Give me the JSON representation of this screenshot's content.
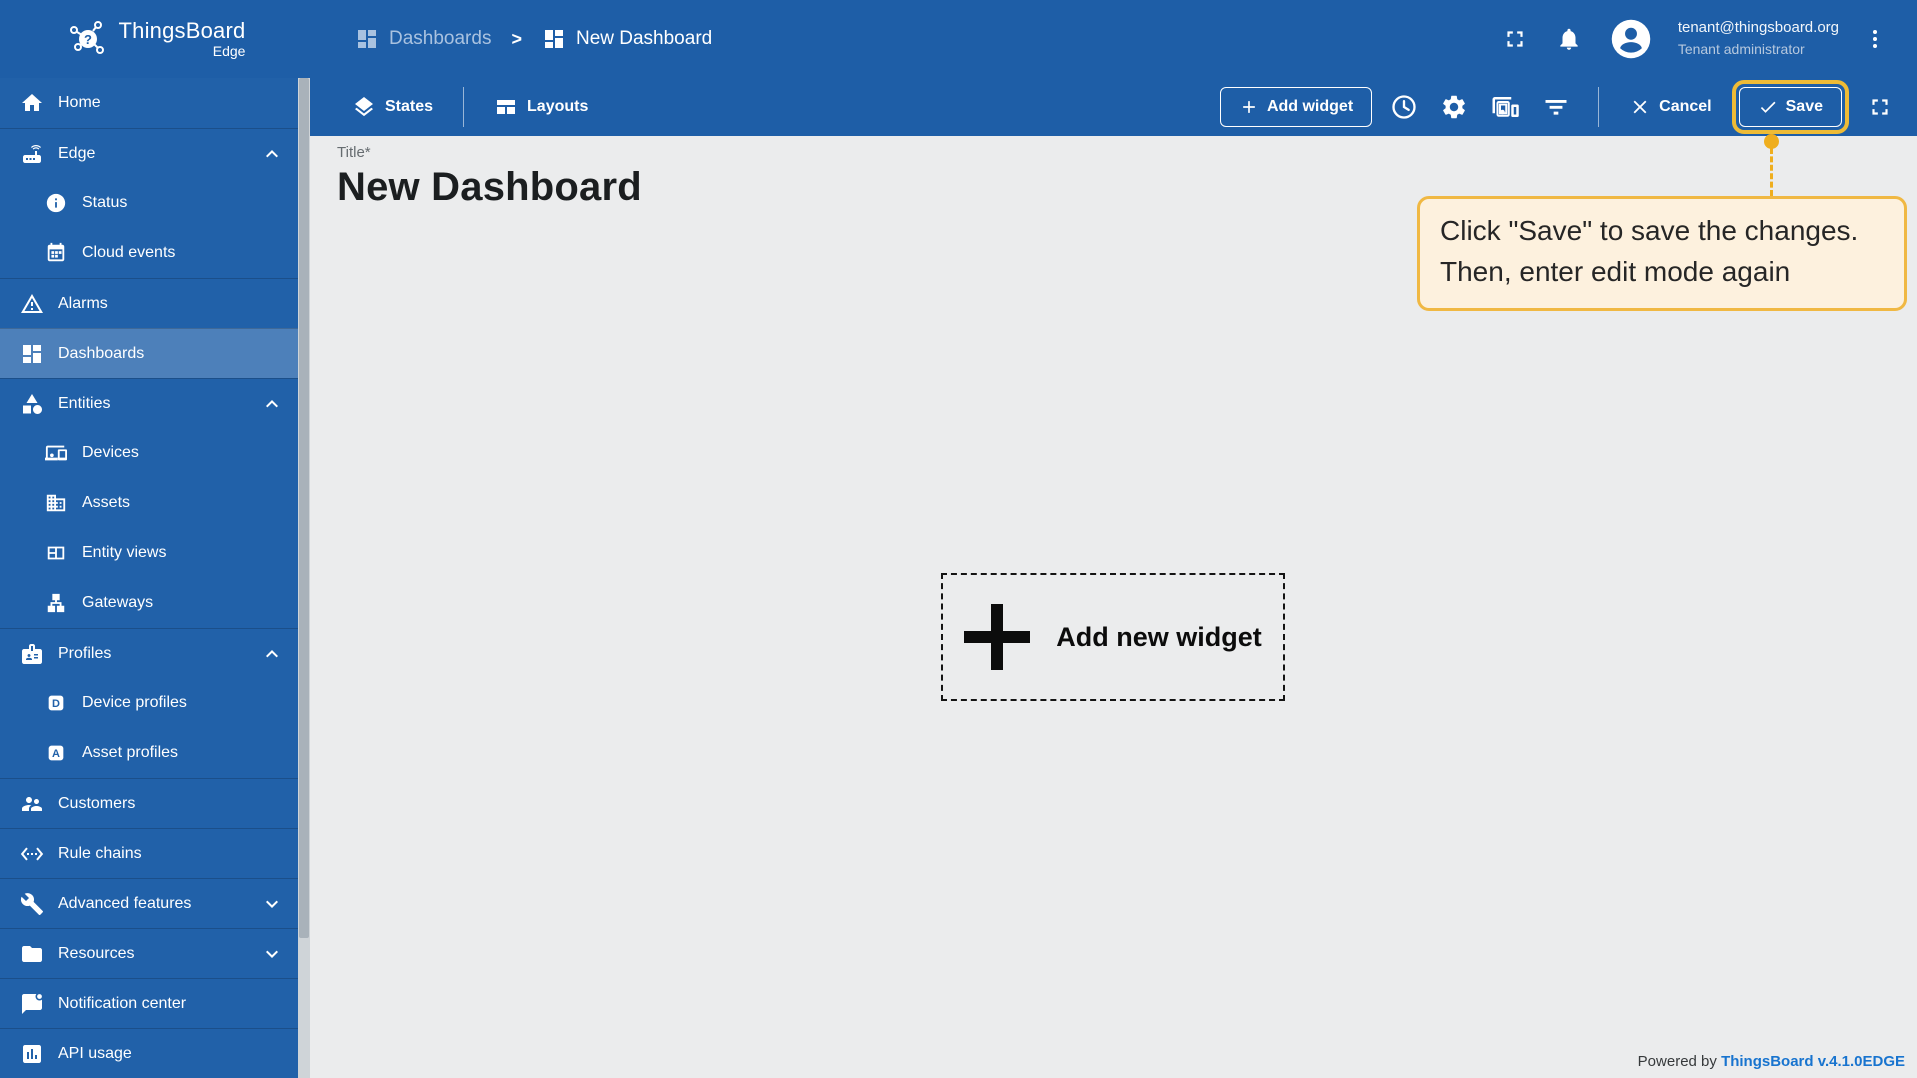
{
  "app": {
    "brand": "ThingsBoard",
    "brand_sub": "Edge"
  },
  "header": {
    "breadcrumb_parent": "Dashboards",
    "separator": ">",
    "breadcrumb_current": "New Dashboard",
    "user": {
      "email": "tenant@thingsboard.org",
      "role": "Tenant administrator"
    }
  },
  "toolbar": {
    "states_label": "States",
    "layouts_label": "Layouts",
    "add_widget_label": "Add widget",
    "cancel_label": "Cancel",
    "save_label": "Save"
  },
  "sidebar": {
    "items": [
      {
        "label": "Home",
        "icon": "home-icon",
        "level": 0
      },
      {
        "label": "Edge",
        "icon": "router-icon",
        "level": 0,
        "expanded": true
      },
      {
        "label": "Status",
        "icon": "info-icon",
        "level": 1
      },
      {
        "label": "Cloud events",
        "icon": "calendar-icon",
        "level": 1
      },
      {
        "label": "Alarms",
        "icon": "warning-icon",
        "level": 0
      },
      {
        "label": "Dashboards",
        "icon": "dashboards-icon",
        "level": 0,
        "selected": true
      },
      {
        "label": "Entities",
        "icon": "shapes-icon",
        "level": 0,
        "expanded": true
      },
      {
        "label": "Devices",
        "icon": "devices-icon",
        "level": 1
      },
      {
        "label": "Assets",
        "icon": "building-icon",
        "level": 1
      },
      {
        "label": "Entity views",
        "icon": "view-grid-icon",
        "level": 1
      },
      {
        "label": "Gateways",
        "icon": "network-icon",
        "level": 1
      },
      {
        "label": "Profiles",
        "icon": "badge-icon",
        "level": 0,
        "expanded": true
      },
      {
        "label": "Device profiles",
        "icon": "letter-d-icon",
        "level": 1
      },
      {
        "label": "Asset profiles",
        "icon": "letter-a-icon",
        "level": 1
      },
      {
        "label": "Customers",
        "icon": "people-icon",
        "level": 0
      },
      {
        "label": "Rule chains",
        "icon": "ethernet-icon",
        "level": 0
      },
      {
        "label": "Advanced features",
        "icon": "tools-icon",
        "level": 0,
        "collapsed": true
      },
      {
        "label": "Resources",
        "icon": "folder-icon",
        "level": 0,
        "collapsed": true
      },
      {
        "label": "Notification center",
        "icon": "notification-icon",
        "level": 0
      },
      {
        "label": "API usage",
        "icon": "chart-icon",
        "level": 0
      }
    ]
  },
  "main": {
    "title_label": "Title*",
    "title_value": "New Dashboard",
    "add_widget_label": "Add new widget"
  },
  "tour": {
    "line1": "Click \"Save\" to save the changes.",
    "line2": "Then, enter edit mode again"
  },
  "footer": {
    "powered_by": "Powered by",
    "version_link": "ThingsBoard v.4.1.0EDGE"
  },
  "colors": {
    "primary_blue": "#1e5ea7",
    "sidebar_blue": "#2161a9",
    "content_bg": "#ebeced",
    "tour_border": "#f0b843",
    "tour_bg": "#fdf1de",
    "highlight_yellow": "#eebb36",
    "link_blue": "#1874cf"
  }
}
